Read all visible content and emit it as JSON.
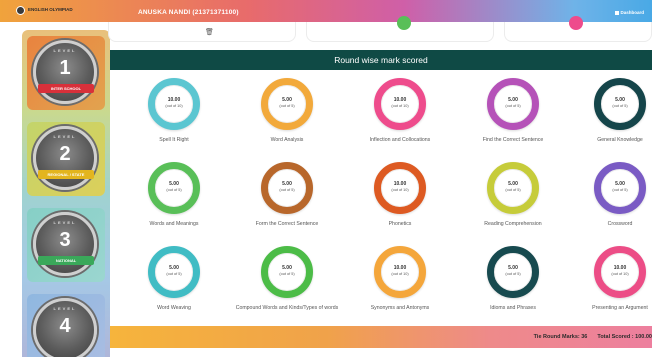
{
  "header": {
    "logo_text": "ENGLISH OLYMPIAD",
    "user_name": "ANUSKA NANDI (21371371100)",
    "right_link": "Dashboard"
  },
  "levels": [
    {
      "tag": "LEVEL",
      "number": "1",
      "label": "INTER SCHOOL",
      "ribbon_color": "#d8303a"
    },
    {
      "tag": "LEVEL",
      "number": "2",
      "label": "REGIONAL / STATE",
      "ribbon_color": "#e3b51e"
    },
    {
      "tag": "LEVEL",
      "number": "3",
      "label": "NATIONAL",
      "ribbon_color": "#3aa85a"
    },
    {
      "tag": "LEVEL",
      "number": "4",
      "label": "",
      "ribbon_color": "#1f78c8"
    }
  ],
  "section_title": "Round wise mark scored",
  "rounds": [
    {
      "score": "10.00",
      "out_of": "(out of 10)",
      "label": "Spell It Right",
      "color": "#5bc6d1"
    },
    {
      "score": "5.00",
      "out_of": "(out of 5)",
      "label": "Word Analysis",
      "color": "#f2a93b"
    },
    {
      "score": "10.00",
      "out_of": "(out of 10)",
      "label": "Inflection and Collocations",
      "color": "#ee4c8c"
    },
    {
      "score": "5.00",
      "out_of": "(out of 5)",
      "label": "Find the Correct Sentence",
      "color": "#b552b8"
    },
    {
      "score": "5.00",
      "out_of": "(out of 5)",
      "label": "General Knowledge",
      "color": "#15454a"
    },
    {
      "score": "5.00",
      "out_of": "(out of 5)",
      "label": "Words and Meanings",
      "color": "#59bf58"
    },
    {
      "score": "5.00",
      "out_of": "(out of 5)",
      "label": "Form the Correct Sentence",
      "color": "#b8672b"
    },
    {
      "score": "10.00",
      "out_of": "(out of 10)",
      "label": "Phonetics",
      "color": "#dd5a22"
    },
    {
      "score": "5.00",
      "out_of": "(out of 5)",
      "label": "Reading Comprehension",
      "color": "#c6cc3a"
    },
    {
      "score": "5.00",
      "out_of": "(out of 5)",
      "label": "Crossword",
      "color": "#7a5bc4"
    },
    {
      "score": "5.00",
      "out_of": "(out of 5)",
      "label": "Word Weaving",
      "color": "#40bcc4"
    },
    {
      "score": "5.00",
      "out_of": "(out of 5)",
      "label": "Compound Words and Kinds/Types of words",
      "color": "#4cbc47"
    },
    {
      "score": "10.00",
      "out_of": "(out of 10)",
      "label": "Synonyms and Antonyms",
      "color": "#f4a63b"
    },
    {
      "score": "5.00",
      "out_of": "(out of 5)",
      "label": "Idioms and Phrases",
      "color": "#174a4f"
    },
    {
      "score": "10.00",
      "out_of": "(out of 10)",
      "label": "Presenting an Argument",
      "color": "#ec4d86"
    }
  ],
  "footer": {
    "tie_round": "Tie Round Marks: 36",
    "total": "Total Scored : 100.00"
  }
}
